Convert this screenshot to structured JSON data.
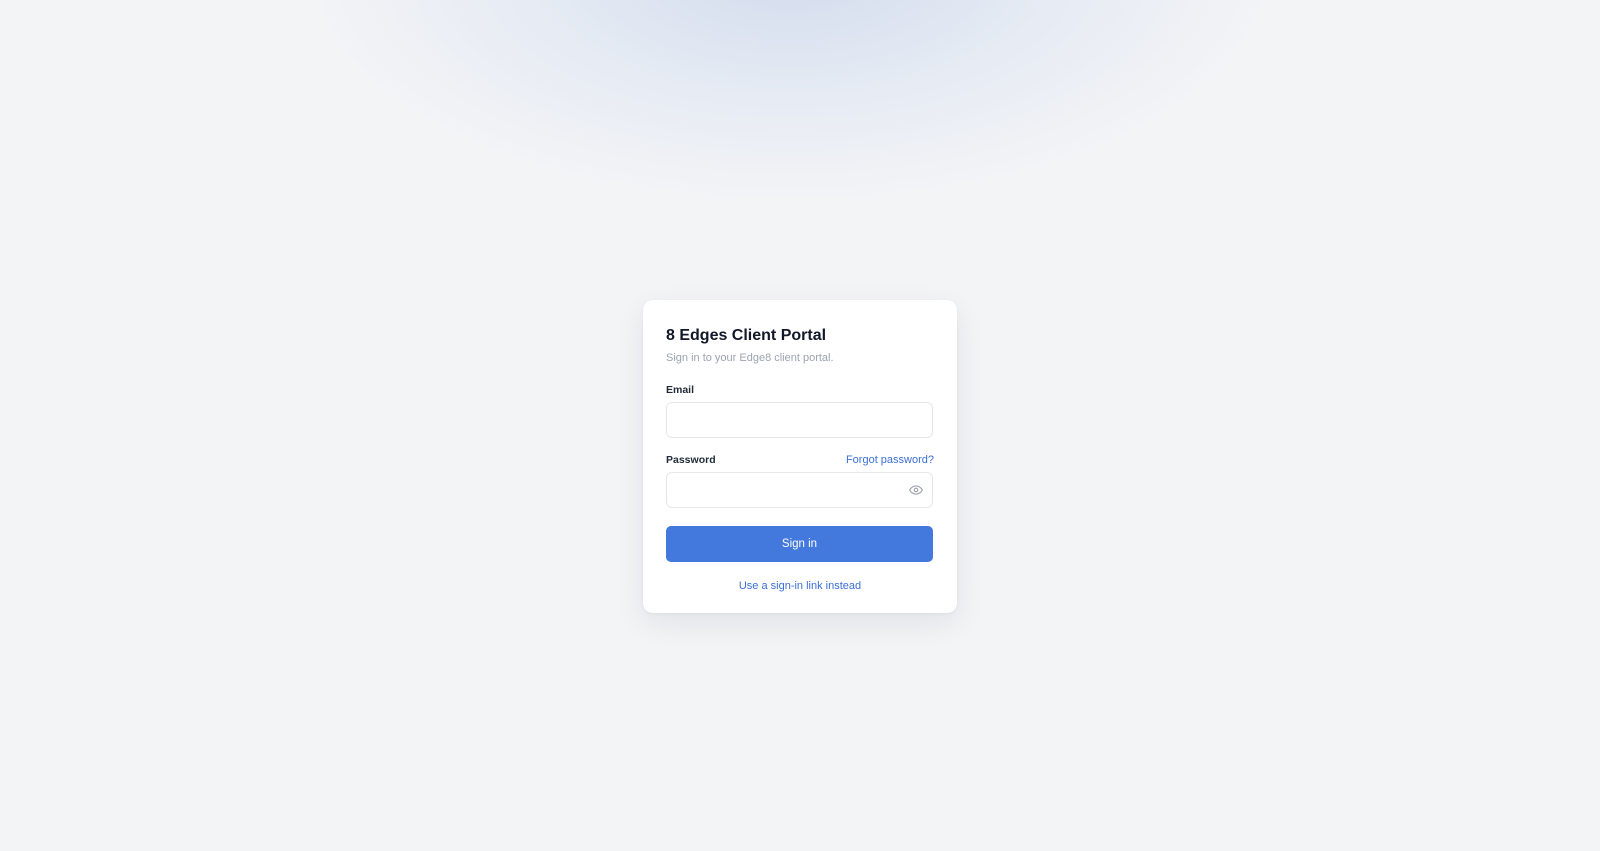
{
  "login": {
    "title": "8 Edges Client Portal",
    "subtitle": "Sign in to your Edge8 client portal.",
    "email": {
      "label": "Email",
      "value": "",
      "placeholder": ""
    },
    "password": {
      "label": "Password",
      "value": "",
      "placeholder": "",
      "forgot_label": "Forgot password?",
      "toggle_icon": "eye-icon"
    },
    "submit_label": "Sign in",
    "alt_link_label": "Use a sign-in link instead"
  },
  "colors": {
    "accent": "#4378dc",
    "link": "#3b6fd6",
    "background": "#f3f4f6",
    "card": "#ffffff"
  }
}
